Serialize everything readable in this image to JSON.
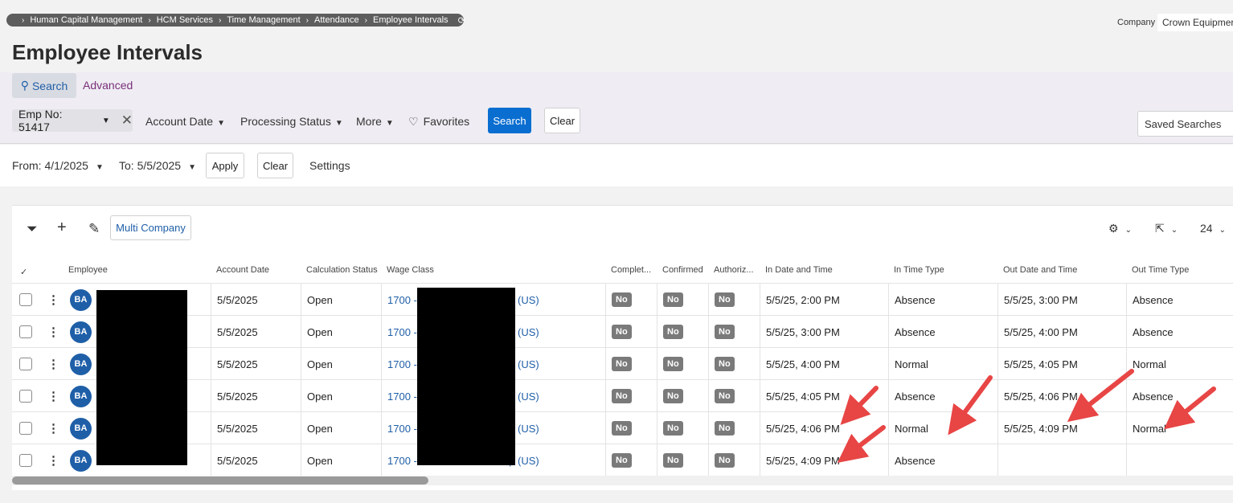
{
  "breadcrumb": {
    "items": [
      "Human Capital Management",
      "HCM Services",
      "Time Management",
      "Attendance",
      "Employee Intervals"
    ],
    "refresh_icon": "refresh-icon"
  },
  "company": {
    "label": "Company",
    "value": "Crown Equipmer"
  },
  "page_title": "Employee Intervals",
  "search_tabs": {
    "search": "Search",
    "advanced": "Advanced"
  },
  "filters": {
    "emp_chip": "Emp No: 51417",
    "account_date": "Account Date",
    "processing_status": "Processing Status",
    "more": "More",
    "favorites": "Favorites",
    "search_button": "Search",
    "clear_button": "Clear",
    "saved_searches": "Saved Searches"
  },
  "date_bar": {
    "from": "From: 4/1/2025",
    "to": "To: 5/5/2025",
    "apply": "Apply",
    "clear": "Clear",
    "settings": "Settings"
  },
  "toolbar": {
    "multi_company": "Multi Company",
    "page_size": "24"
  },
  "columns": {
    "employee": "Employee",
    "account_date": "Account Date",
    "calc_status": "Calculation Status",
    "wage_class": "Wage Class",
    "completed": "Complet...",
    "confirmed": "Confirmed",
    "authorized": "Authoriz...",
    "in_dt": "In Date and Time",
    "in_type": "In Time Type",
    "out_dt": "Out Date and Time",
    "out_type": "Out Time Type"
  },
  "rows": [
    {
      "initials": "BA",
      "account_date": "5/5/2025",
      "calc_status": "Open",
      "wage_a": "1700 -",
      "wage_b": "rp (US)",
      "completed": "No",
      "confirmed": "No",
      "authorized": "No",
      "in_dt": "5/5/25, 2:00 PM",
      "in_type": "Absence",
      "out_dt": "5/5/25, 3:00 PM",
      "out_type": "Absence"
    },
    {
      "initials": "BA",
      "account_date": "5/5/2025",
      "calc_status": "Open",
      "wage_a": "1700 -",
      "wage_b": "rp (US)",
      "completed": "No",
      "confirmed": "No",
      "authorized": "No",
      "in_dt": "5/5/25, 3:00 PM",
      "in_type": "Absence",
      "out_dt": "5/5/25, 4:00 PM",
      "out_type": "Absence"
    },
    {
      "initials": "BA",
      "account_date": "5/5/2025",
      "calc_status": "Open",
      "wage_a": "1700 -",
      "wage_b": "rp (US)",
      "completed": "No",
      "confirmed": "No",
      "authorized": "No",
      "in_dt": "5/5/25, 4:00 PM",
      "in_type": "Normal",
      "out_dt": "5/5/25, 4:05 PM",
      "out_type": "Normal"
    },
    {
      "initials": "BA",
      "account_date": "5/5/2025",
      "calc_status": "Open",
      "wage_a": "1700 -",
      "wage_b": "rp (US)",
      "completed": "No",
      "confirmed": "No",
      "authorized": "No",
      "in_dt": "5/5/25, 4:05 PM",
      "in_type": "Absence",
      "out_dt": "5/5/25, 4:06 PM",
      "out_type": "Absence"
    },
    {
      "initials": "BA",
      "account_date": "5/5/2025",
      "calc_status": "Open",
      "wage_a": "1700 -",
      "wage_b": "rp (US)",
      "completed": "No",
      "confirmed": "No",
      "authorized": "No",
      "in_dt": "5/5/25, 4:06 PM",
      "in_type": "Normal",
      "out_dt": "5/5/25, 4:09 PM",
      "out_type": "Normal"
    },
    {
      "initials": "BA",
      "account_date": "5/5/2025",
      "calc_status": "Open",
      "wage_a": "1700 -",
      "wage_b": "rp (US)",
      "completed": "No",
      "confirmed": "No",
      "authorized": "No",
      "in_dt": "5/5/25, 4:09 PM",
      "in_type": "Absence",
      "out_dt": "",
      "out_type": ""
    }
  ],
  "annotation_color": "#e84545"
}
